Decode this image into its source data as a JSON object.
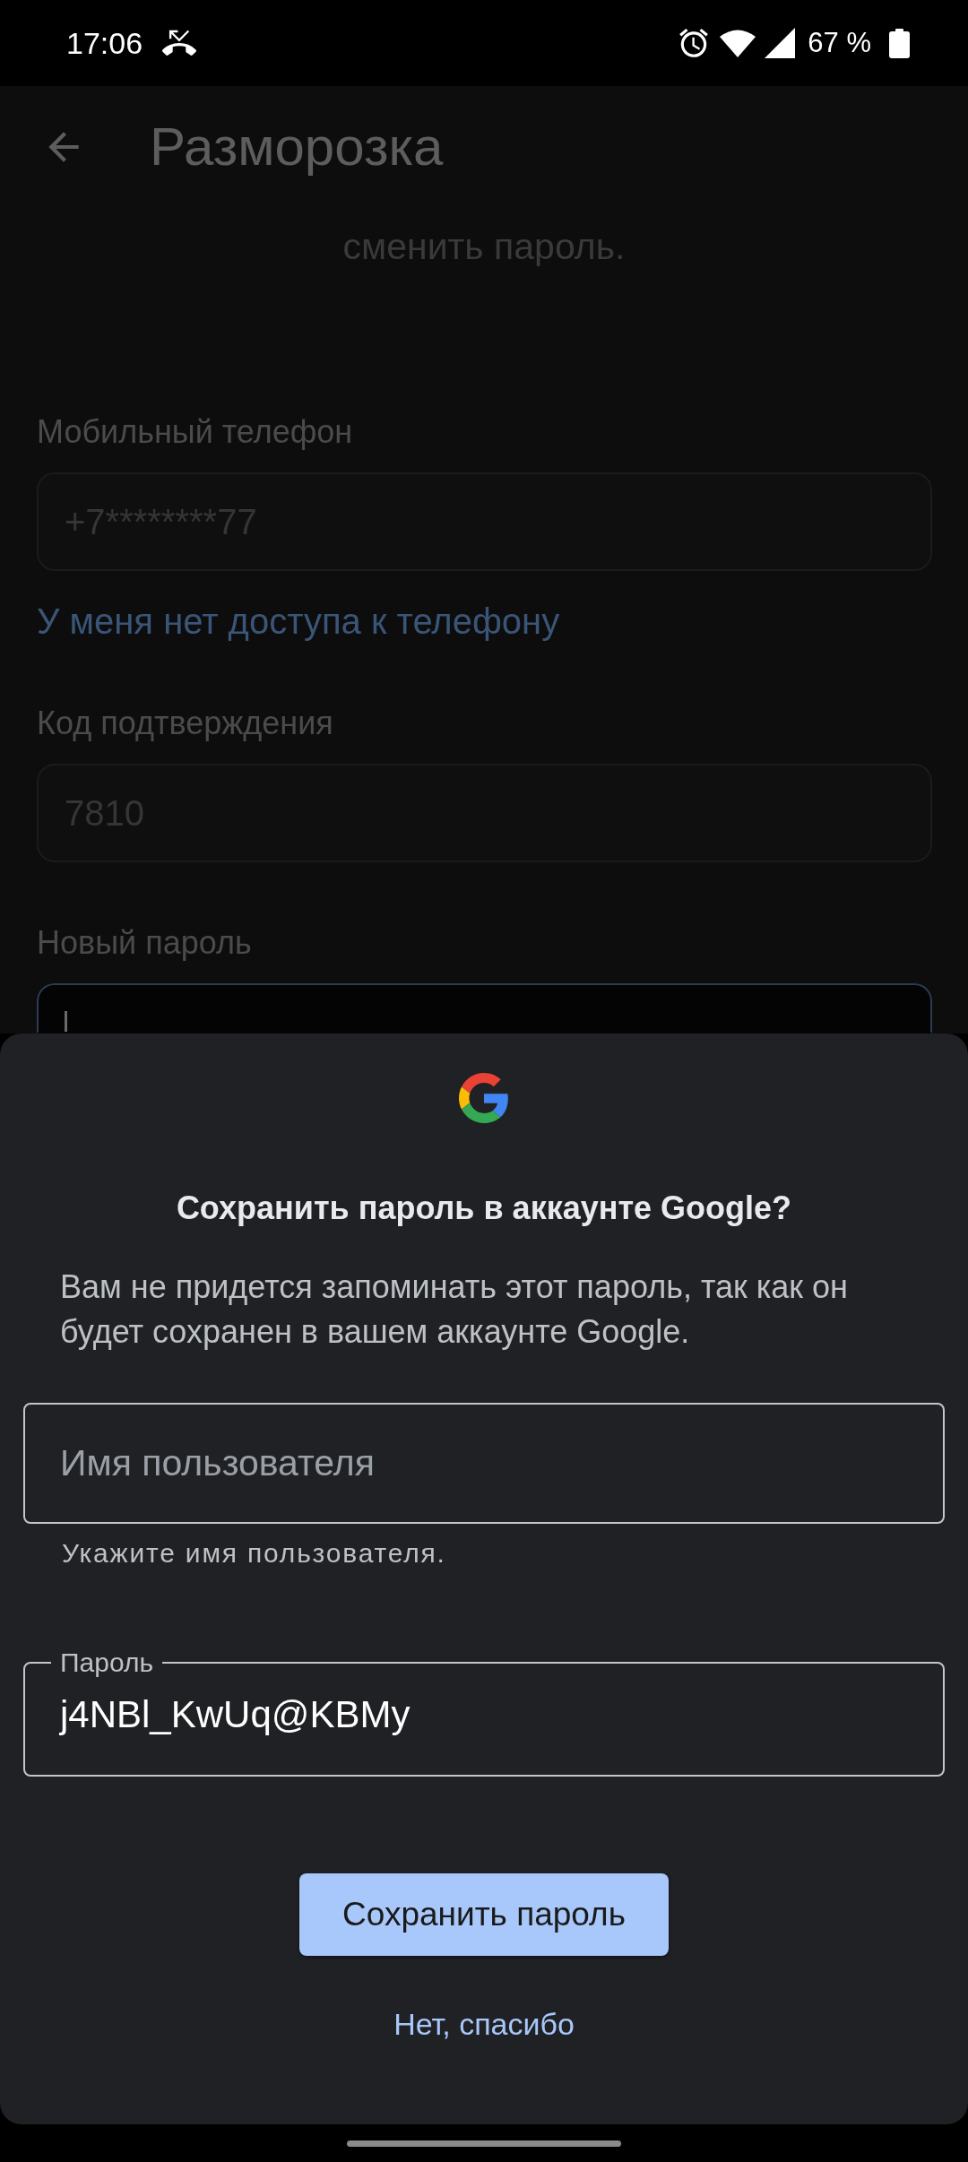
{
  "status_bar": {
    "time": "17:06",
    "battery": "67 %"
  },
  "app_bar": {
    "title": "Разморозка"
  },
  "form": {
    "intro": "сменить пароль.",
    "items": [
      {
        "kind": "field",
        "label": "Мобильный телефон",
        "value": "+7********77",
        "focused": false
      },
      {
        "kind": "link",
        "text": "У меня нет доступа к телефону"
      },
      {
        "kind": "field",
        "label": "Код подтверждения",
        "value": "7810",
        "focused": false
      },
      {
        "kind": "field",
        "label": "Новый пароль",
        "focused": true
      }
    ]
  },
  "save_password_sheet": {
    "title": "Сохранить пароль в аккаунте Google?",
    "message": "Вам не придется запоминать этот пароль, так как он будет сохранен в вашем аккаунте Google.",
    "username_field": {
      "placeholder": "Имя пользователя",
      "helper": "Укажите имя пользователя."
    },
    "password_field": {
      "label": "Пароль",
      "value": "j4NBl_KwUq@KBMy"
    },
    "buttons": [
      {
        "kind": "primary",
        "label": "Сохранить пароль"
      },
      {
        "kind": "text",
        "label": "Нет, спасибо"
      }
    ]
  }
}
